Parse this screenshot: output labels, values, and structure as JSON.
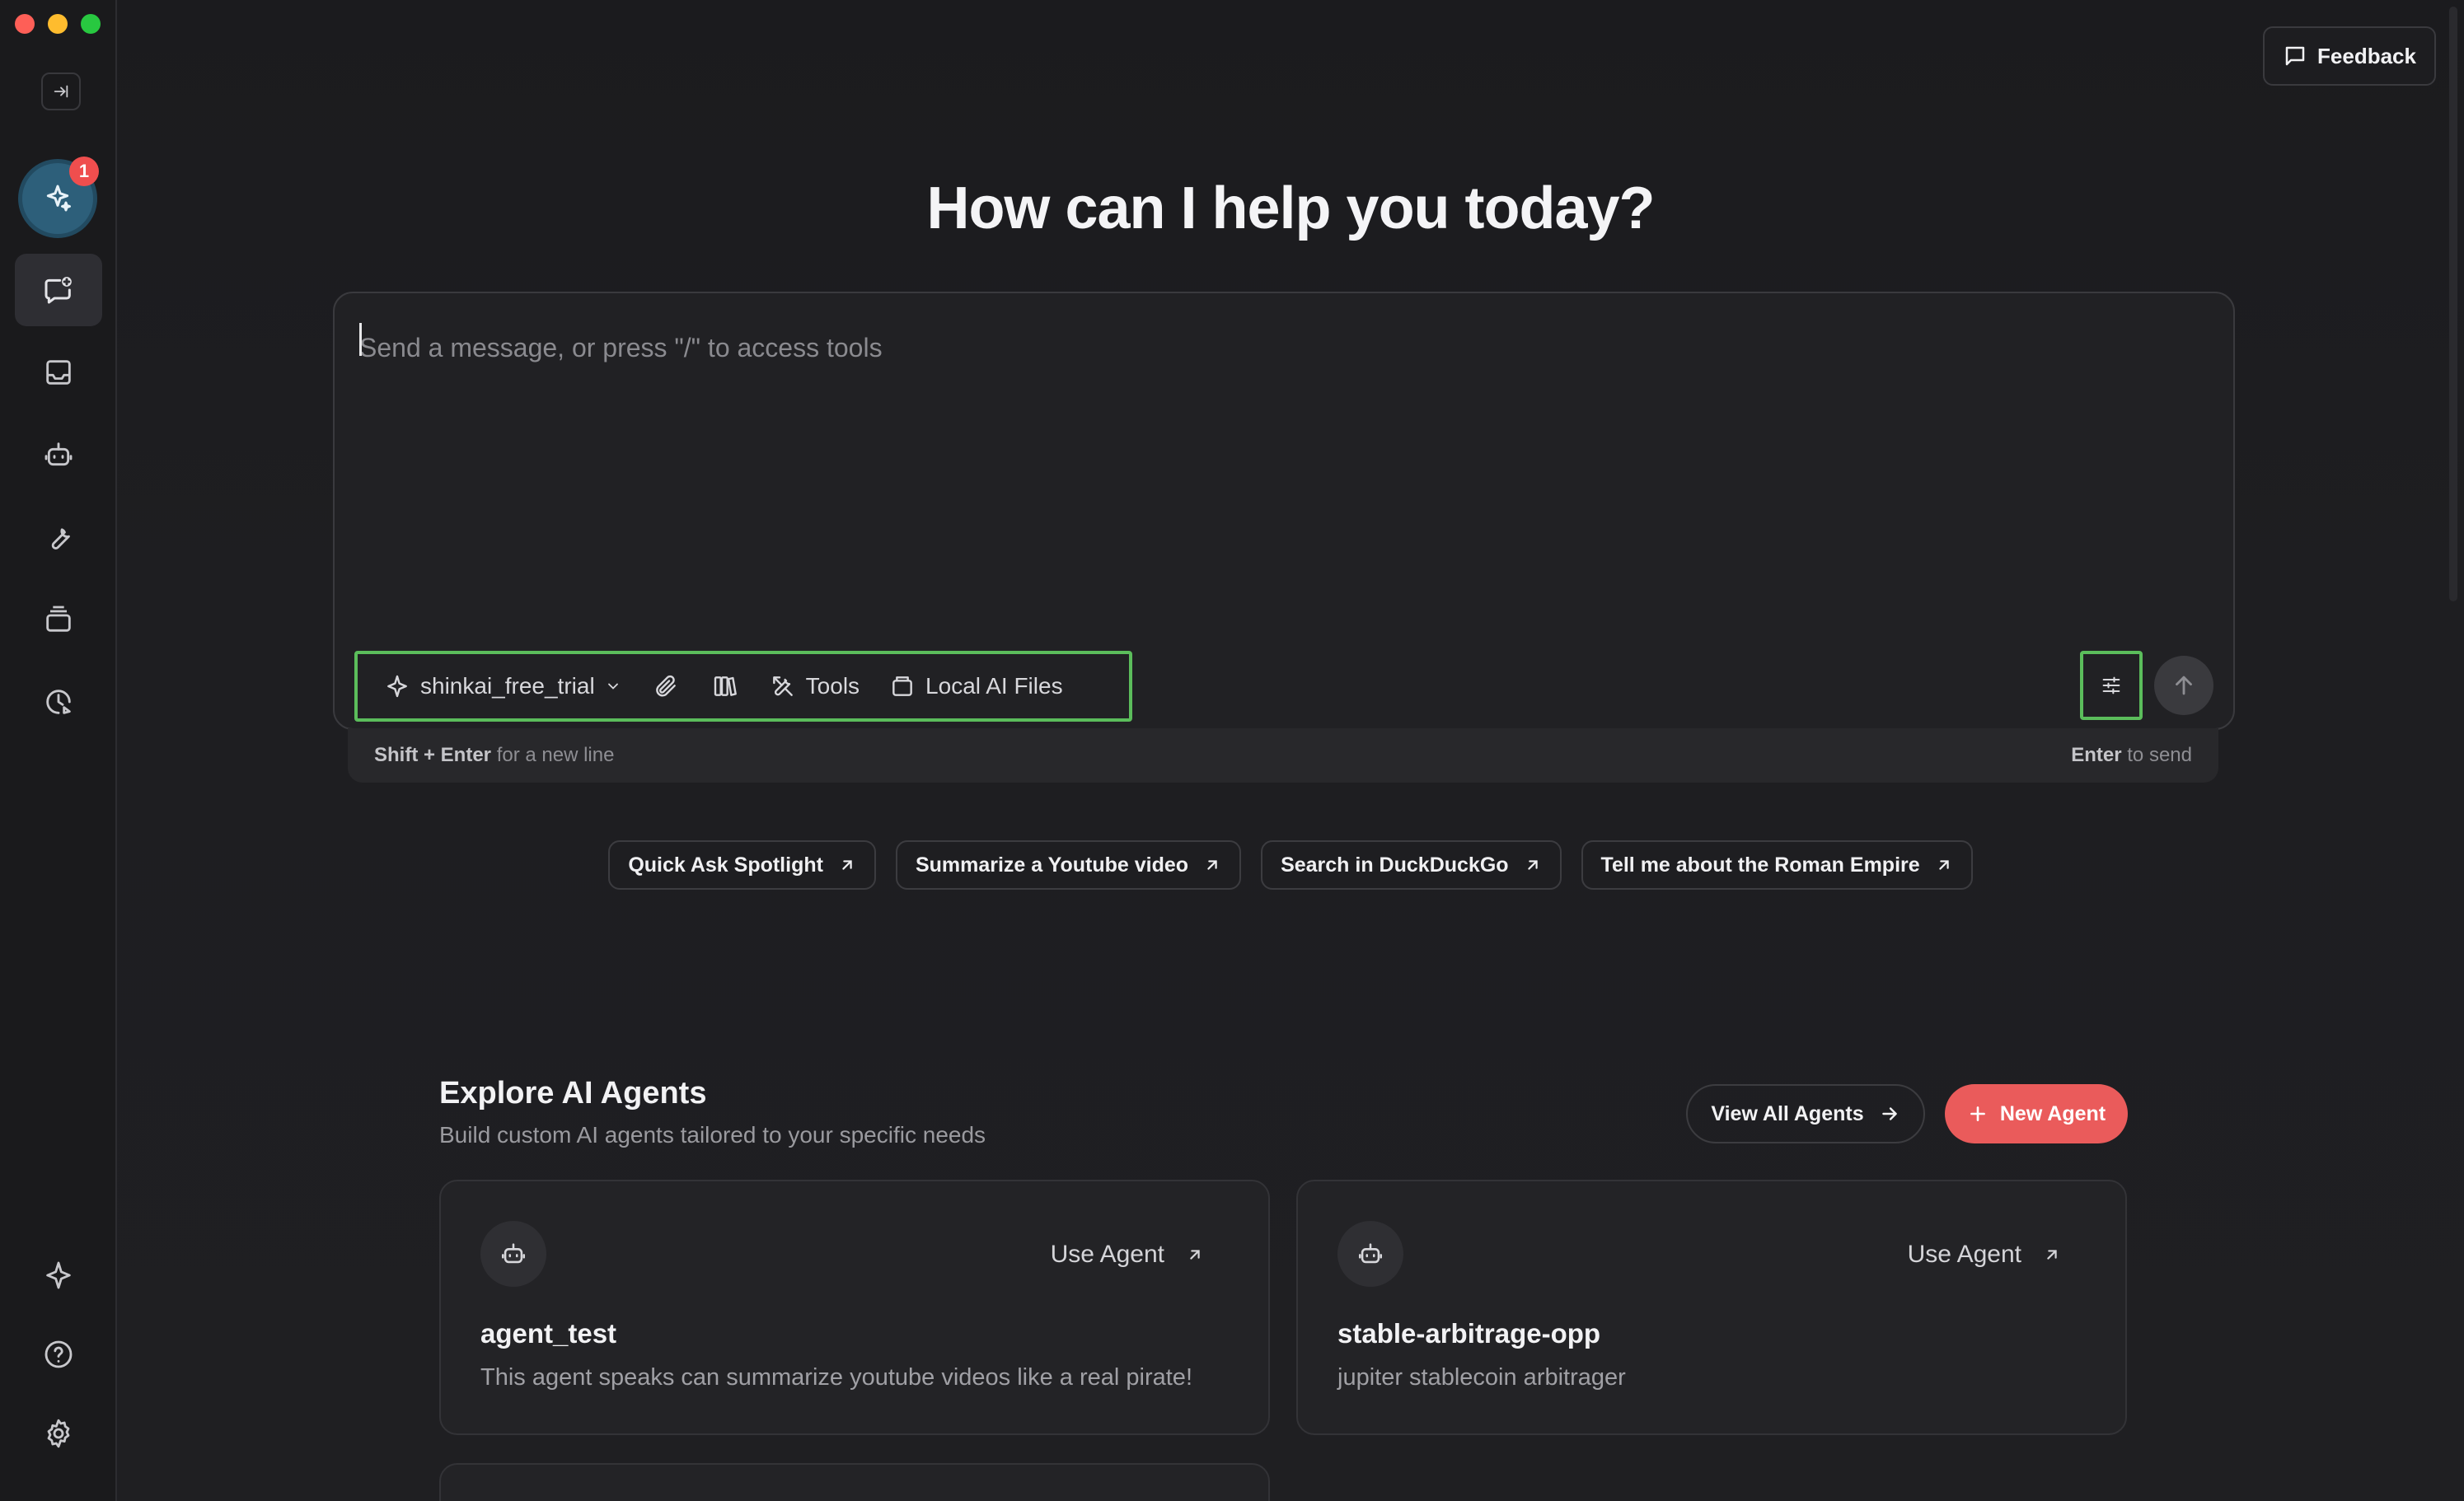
{
  "window": {
    "traffic_lights": [
      "close",
      "minimize",
      "zoom"
    ]
  },
  "sidebar": {
    "notification_count": "1",
    "items": [
      {
        "name": "new-chat",
        "icon": "chat-plus-icon",
        "active": true
      },
      {
        "name": "inbox",
        "icon": "inbox-icon",
        "active": false
      },
      {
        "name": "agents",
        "icon": "robot-icon",
        "active": false
      },
      {
        "name": "tools",
        "icon": "wrench-icon",
        "active": false
      },
      {
        "name": "files",
        "icon": "archive-icon",
        "active": false
      },
      {
        "name": "tasks",
        "icon": "clock-icon",
        "active": false
      },
      {
        "name": "spark",
        "icon": "sparkle-icon",
        "active": false
      },
      {
        "name": "help",
        "icon": "help-icon",
        "active": false
      },
      {
        "name": "settings",
        "icon": "gear-icon",
        "active": false
      }
    ]
  },
  "header": {
    "feedback_label": "Feedback"
  },
  "hero": {
    "title": "How can I help you today?"
  },
  "composer": {
    "placeholder": "Send a message, or press \"/\" to access tools",
    "value": "",
    "model_label": "shinkai_free_trial",
    "tools_label": "Tools",
    "local_files_label": "Local AI Files",
    "hint_left_key": "Shift + Enter",
    "hint_left_text": " for a new line",
    "hint_right_key": "Enter",
    "hint_right_text": " to send"
  },
  "suggestions": [
    "Quick Ask Spotlight",
    "Summarize a Youtube video",
    "Search in DuckDuckGo",
    "Tell me about the Roman Empire"
  ],
  "explore": {
    "title": "Explore AI Agents",
    "subtitle": "Build custom AI agents tailored to your specific needs",
    "view_all_label": "View All Agents",
    "new_agent_label": "New Agent",
    "agents": [
      {
        "name": "agent_test",
        "description": "This agent speaks can summarize youtube videos like a real pirate!",
        "use_label": "Use Agent"
      },
      {
        "name": "stable-arbitrage-opp",
        "description": "jupiter stablecoin arbitrager",
        "use_label": "Use Agent"
      }
    ]
  },
  "colors": {
    "accent_new_agent": "#ea5b5b",
    "highlight_outline": "#5bbd5b",
    "badge": "#ef4e4e",
    "background": "#1f1e21"
  }
}
